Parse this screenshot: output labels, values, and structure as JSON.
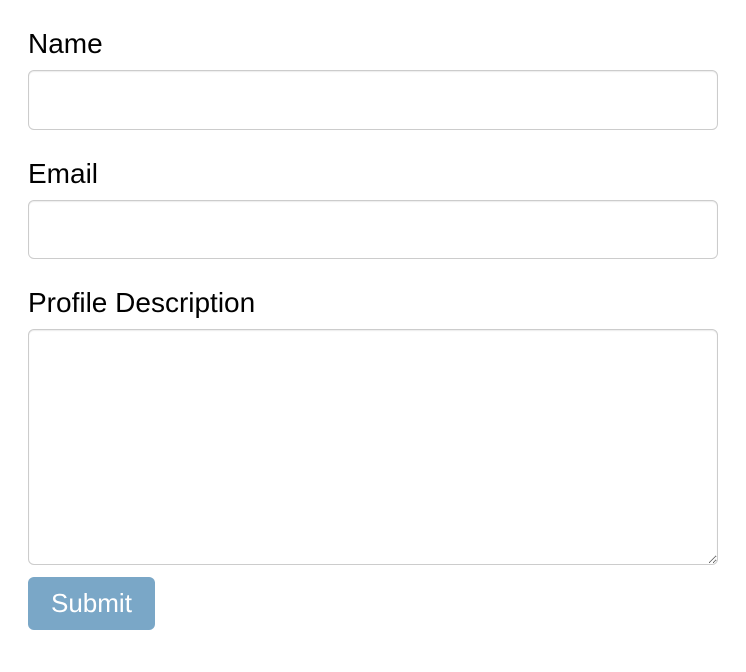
{
  "form": {
    "name": {
      "label": "Name",
      "value": ""
    },
    "email": {
      "label": "Email",
      "value": ""
    },
    "profile_description": {
      "label": "Profile Description",
      "value": ""
    },
    "submit": {
      "label": "Submit"
    }
  }
}
